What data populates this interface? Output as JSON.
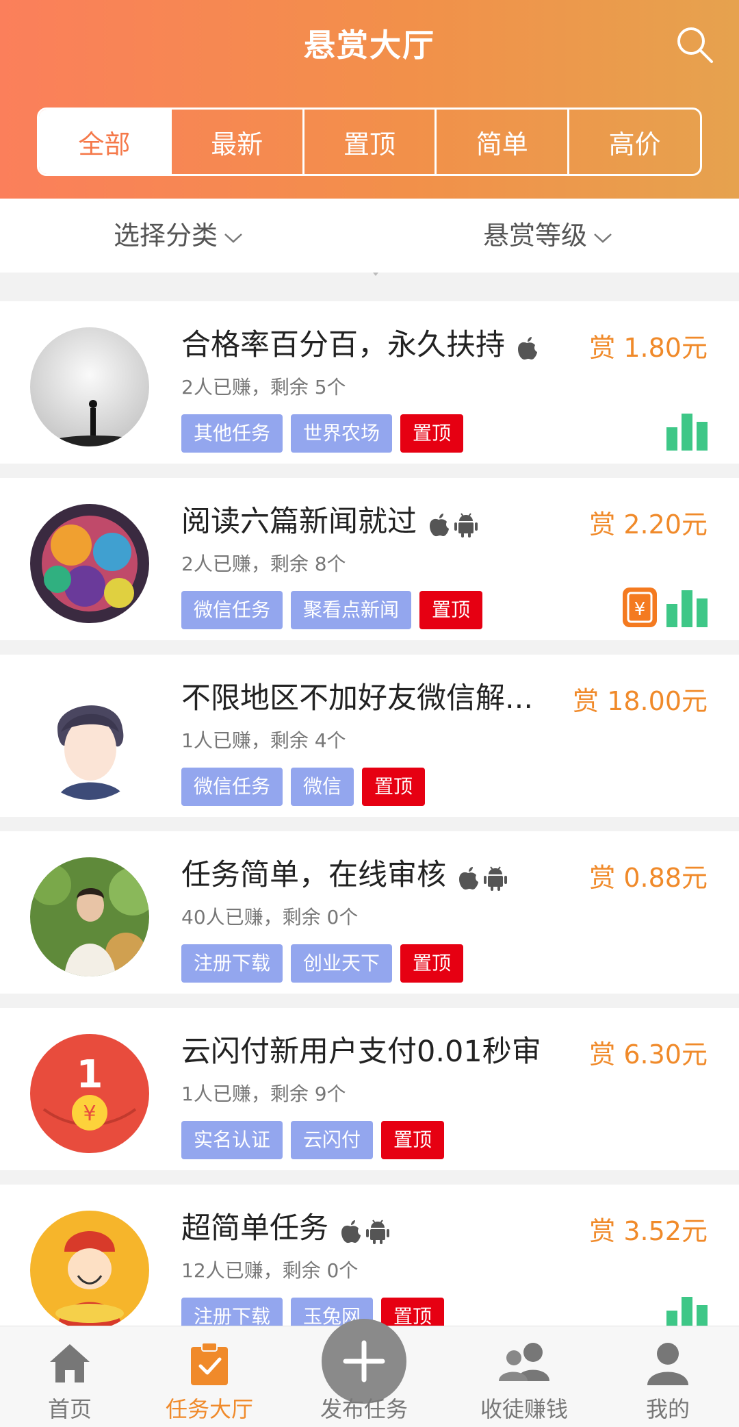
{
  "header": {
    "title": "悬赏大厅"
  },
  "tabs": [
    "全部",
    "最新",
    "置顶",
    "简单",
    "高价"
  ],
  "filters": {
    "category": "选择分类",
    "level": "悬赏等级"
  },
  "colors": {
    "accent": "#f08a2a",
    "tag_blue": "#93a6ee",
    "tag_red": "#e60012",
    "bar_green": "#3ec787"
  },
  "tasks": [
    {
      "title": "合格率百分百，永久扶持",
      "meta": "2人已赚，剩余 5个",
      "reward": "赏 1.80元",
      "tags": [
        "其他任务",
        "世界农场",
        "置顶"
      ],
      "os": [
        "apple-icon"
      ]
    },
    {
      "title": "阅读六篇新闻就过",
      "meta": "2人已赚，剩余 8个",
      "reward": "赏 2.20元",
      "tags": [
        "微信任务",
        "聚看点新闻",
        "置顶"
      ],
      "os": [
        "apple-icon",
        "android-icon"
      ]
    },
    {
      "title": "不限地区不加好友微信解...",
      "meta": "1人已赚，剩余 4个",
      "reward": "赏 18.00元",
      "tags": [
        "微信任务",
        "微信",
        "置顶"
      ],
      "os": []
    },
    {
      "title": "任务简单，在线审核",
      "meta": "40人已赚，剩余 0个",
      "reward": "赏 0.88元",
      "tags": [
        "注册下载",
        "创业天下",
        "置顶"
      ],
      "os": [
        "apple-icon",
        "android-icon"
      ]
    },
    {
      "title": "云闪付新用户支付0.01秒审",
      "meta": "1人已赚，剩余 9个",
      "reward": "赏 6.30元",
      "tags": [
        "实名认证",
        "云闪付",
        "置顶"
      ],
      "os": []
    },
    {
      "title": "超简单任务",
      "meta": "12人已赚，剩余 0个",
      "reward": "赏 3.52元",
      "tags": [
        "注册下载",
        "玉兔网",
        "置顶"
      ],
      "os": [
        "apple-icon",
        "android-icon"
      ]
    }
  ],
  "tabbar": [
    "首页",
    "任务大厅",
    "发布任务",
    "收徒赚钱",
    "我的"
  ]
}
